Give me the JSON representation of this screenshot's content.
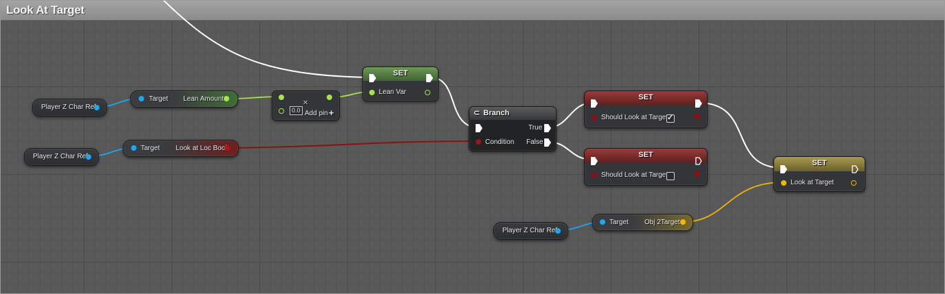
{
  "graph": {
    "title": "Look At Target"
  },
  "nodes": {
    "ref1": {
      "label": "Player Z Char Ref"
    },
    "ref2": {
      "label": "Player Z Char Ref"
    },
    "ref3": {
      "label": "Player Z Char Ref"
    },
    "get_lean": {
      "in_label": "Target",
      "out_label": "Lean Amount"
    },
    "get_look": {
      "in_label": "Target",
      "out_label": "Look at Loc Bool"
    },
    "get_obj": {
      "in_label": "Target",
      "out_label": "Obj 2Target"
    },
    "add": {
      "value": "0.0",
      "add_pin": "Add pin",
      "close_glyph": "✕",
      "plus_glyph": "+"
    },
    "set_lean": {
      "header": "SET",
      "var": "Lean Var"
    },
    "branch": {
      "header": "Branch",
      "icon": "⊂",
      "condition": "Condition",
      "true_label": "True",
      "false_label": "False"
    },
    "set_true": {
      "header": "SET",
      "var": "Should Look at Target",
      "checked": true
    },
    "set_false": {
      "header": "SET",
      "var": "Should Look at Target",
      "checked": false
    },
    "set_look": {
      "header": "SET",
      "var": "Look at Target"
    }
  },
  "colors": {
    "object": "#1ea7f0",
    "float": "#a4e64a",
    "bool": "#8f0f0f",
    "struct": "#f2b705",
    "exec": "#ffffff",
    "set_header_green": "#4e7a3a",
    "set_header_red": "#7a2a2a",
    "set_header_gold": "#8a7a32",
    "get_header_green": "#3f6e34",
    "get_header_red": "#6e1f1f",
    "get_header_gold": "#7a6a2a"
  }
}
